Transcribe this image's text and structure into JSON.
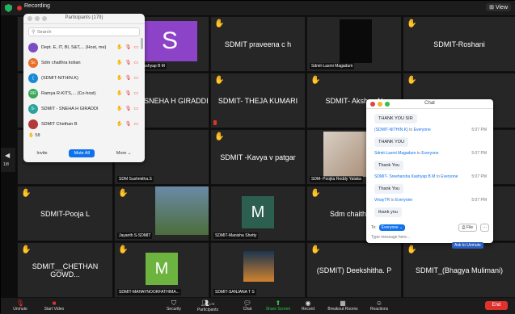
{
  "topbar": {
    "recording_label": "Recording",
    "view_label": "View"
  },
  "participants_panel": {
    "title": "Participants (179)",
    "search_placeholder": "Search",
    "rows": [
      {
        "initials": "",
        "avatar_color": "#7c4cc4",
        "name": "Dept. E, IT, BI, S&T,... (Host, me)"
      },
      {
        "initials": "Sc",
        "avatar_color": "#e8712a",
        "name": "Sdm chaithra kotian"
      },
      {
        "initials": "(",
        "avatar_color": "#1b8ad6",
        "name": "(SDMIT-NITHIN.K)"
      },
      {
        "initials": "RR",
        "avatar_color": "#3aa858",
        "name": "Ramya R-KITS,...  (Co-host)"
      },
      {
        "initials": "S-",
        "avatar_color": "#2aa39a",
        "name": "SDMIT - SNEHA H GIRADDI"
      },
      {
        "initials": "",
        "avatar_color": "#b33a3a",
        "name": "SDMIT Chethan B"
      }
    ],
    "count_partial": "58",
    "invite_label": "Invite",
    "mute_all_label": "Mute All",
    "more_label": "More ⌄"
  },
  "tiles": {
    "t_row1_2_label": "Sreeharsha Kashyap B M",
    "t_row1_3_name": "SDMIT  praveena c h",
    "t_row1_4_label": "Sdmit-Laxmi Magadum",
    "t_row1_5_name": "SDMIT-Roshani",
    "t_row2_2_name": "SDMIT - SNEHA H GIRADDI",
    "t_row2_3_name": "SDMIT- THEJA KUMARI",
    "t_row2_4_name": "SDMIT- Akshay N",
    "t_row3_2_label": "SDM Sushmitha.S",
    "t_row3_3_name": "SDMIT -Kavya v patgar",
    "t_row3_4_label": "SDM- Poojita Reddy Yataka",
    "t_row4_1_name": "SDMIT-Pooja L",
    "t_row4_2_label": "Jayanth S-SDMIT",
    "t_row4_3_label": "SDMIT-Manisha Shetty",
    "t_row4_3_letter": "M",
    "t_row4_4_name": "Sdm chaithra k",
    "t_row5_1_name": "SDMIT__CHETHAN GOWD...",
    "t_row5_2_label": "SDMIT-MAHAYNOORFATHIMA...",
    "t_row5_2_letter": "M",
    "t_row5_3_label": "SDMIT-SANJANA T S",
    "t_row5_4_name": "(SDMIT) Deekshitha. P",
    "t_row5_5_name": "SDMIT_(Bhagya Mulimani)",
    "avatar_s_letter": "S"
  },
  "chat_panel": {
    "title": "Chat",
    "messages": [
      {
        "from": "",
        "to": "",
        "time": "",
        "text": "THANK YOU SIR"
      },
      {
        "from": "(SDMIT-NITHIN.K)",
        "to": "Everyone",
        "time": "5:07 PM",
        "text": "THANK YOU"
      },
      {
        "from": "Sdmit-Laxmi Magadum",
        "to": "Everyone",
        "time": "5:07 PM",
        "text": "Thank You"
      },
      {
        "from": "SDMIT- Sreeharsha Kashyap B M",
        "to": "Everyone",
        "time": "5:07 PM",
        "text": "Thank You"
      },
      {
        "from": "VinayTR",
        "to": "Everyone",
        "time": "5:07 PM",
        "text": "thank you"
      }
    ],
    "to_label": "To:",
    "everyone_label": "Everyone ⌄",
    "file_label": "File",
    "more_label": "···",
    "input_placeholder": "Type message here..."
  },
  "ask_unmute_label": "Ask to Unmute",
  "side_page": "1/8",
  "toolbar": {
    "unmute": "Unmute",
    "start_video": "Start Video",
    "security": "Security",
    "participants": "Participants",
    "participants_count": "179",
    "chat": "Chat",
    "share_screen": "Share Screen",
    "record": "Record",
    "breakout_rooms": "Breakout Rooms",
    "reactions": "Reactions",
    "end": "End"
  }
}
